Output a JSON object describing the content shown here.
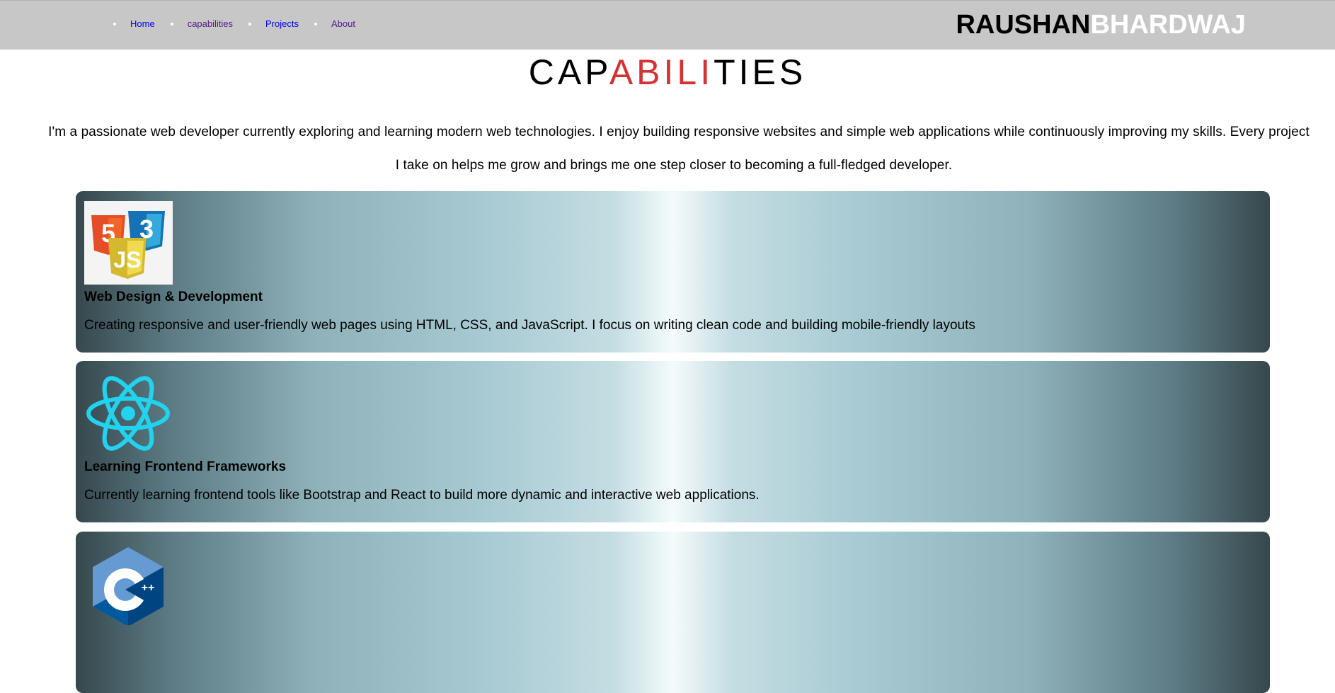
{
  "nav": {
    "items": [
      {
        "label": "Home"
      },
      {
        "label": "capabilities"
      },
      {
        "label": "Projects"
      },
      {
        "label": "About"
      }
    ]
  },
  "brand": {
    "first": "RAUSHAN",
    "last": "BHARDWAJ"
  },
  "title": {
    "part1": "CAP",
    "part2": "ABILI",
    "part3": "TIES"
  },
  "intro": {
    "line1": "I'm a passionate web developer currently exploring and learning modern web technologies. I enjoy building responsive websites and simple web applications while continuously improving my skills. Every project",
    "line2": "I take on helps me grow and brings me one step closer to becoming a full-fledged developer."
  },
  "cards": [
    {
      "icon": "html-css-js-icon",
      "title": "Web Design & Development",
      "description": "Creating responsive and user-friendly web pages using HTML, CSS, and JavaScript. I focus on writing clean code and building mobile-friendly layouts"
    },
    {
      "icon": "react-icon",
      "title": "Learning Frontend Frameworks",
      "description": "Currently learning frontend tools like Bootstrap and React to build more dynamic and interactive web applications."
    },
    {
      "icon": "cpp-icon",
      "title": "",
      "description": ""
    }
  ],
  "colors": {
    "header_bg": "#c7c7c7",
    "accent_red": "#d33333",
    "link_blue": "#0000ee",
    "link_visited": "#551a8b"
  }
}
